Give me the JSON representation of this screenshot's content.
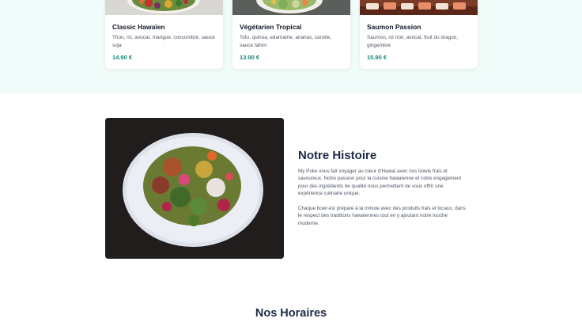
{
  "menu": {
    "cards": [
      {
        "title": "Classic Hawaïen",
        "description": "Thon, riz, avocat, mangue, concombre, sauce soja",
        "price": "14.90 €"
      },
      {
        "title": "Végétarien Tropical",
        "description": "Tofu, quinoa, edamame, ananas, carotte, sauce tahini",
        "price": "13.90 €"
      },
      {
        "title": "Saumon Passion",
        "description": "Saumon, riz noir, avocat, fruit du dragon, gingembre",
        "price": "15.90 €"
      }
    ]
  },
  "story": {
    "title": "Notre Histoire",
    "paragraph1": "My Poke vous fait voyager au cœur d'Hawaï avec nos bowls frais et savoureux. Notre passion pour la cuisine hawaïenne et notre engagement pour des ingrédients de qualité nous permettent de vous offrir une expérience culinaire unique.",
    "paragraph2": "Chaque bowl est préparé à la minute avec des produits frais et locaux, dans le respect des traditions hawaïennes tout en y ajoutant notre touche moderne."
  },
  "hours": {
    "title": "Nos Horaires"
  }
}
